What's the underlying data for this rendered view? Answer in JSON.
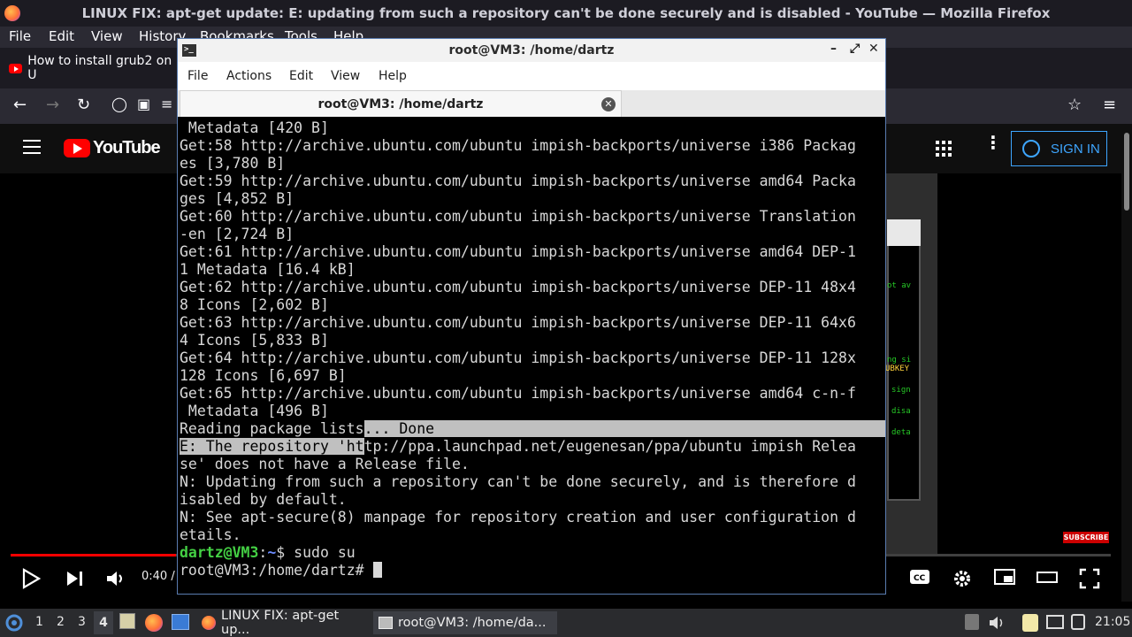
{
  "firefox": {
    "window_title": "LINUX FIX: apt-get update: E: updating from such a repository can't be done securely and is disabled - YouTube — Mozilla Firefox",
    "menu": [
      "File",
      "Edit",
      "View",
      "History",
      "Bookmarks",
      "Tools",
      "Help"
    ],
    "tab_label": "How to install grub2 on U"
  },
  "youtube": {
    "logo_text": "YouTube",
    "sign_in_label": "SIGN IN",
    "subscribe_label": "SUBSCRIBE",
    "time": "0:40 /",
    "inner_screen_lines": [
      "ot av",
      "ng si",
      "UBKEY",
      "sign",
      "disa",
      "deta"
    ],
    "progress": 0.15
  },
  "terminal": {
    "window_title": "root@VM3: /home/dartz",
    "menu": [
      "File",
      "Actions",
      "Edit",
      "View",
      "Help"
    ],
    "tab_title": "root@VM3: /home/dartz",
    "lines": [
      " Metadata [420 B]",
      "Get:58 http://archive.ubuntu.com/ubuntu impish-backports/universe i386 Packag",
      "es [3,780 B]",
      "Get:59 http://archive.ubuntu.com/ubuntu impish-backports/universe amd64 Packa",
      "ges [4,852 B]",
      "Get:60 http://archive.ubuntu.com/ubuntu impish-backports/universe Translation",
      "-en [2,724 B]",
      "Get:61 http://archive.ubuntu.com/ubuntu impish-backports/universe amd64 DEP-1",
      "1 Metadata [16.4 kB]",
      "Get:62 http://archive.ubuntu.com/ubuntu impish-backports/universe DEP-11 48x4",
      "8 Icons [2,602 B]",
      "Get:63 http://archive.ubuntu.com/ubuntu impish-backports/universe DEP-11 64x6",
      "4 Icons [5,833 B]",
      "Get:64 http://archive.ubuntu.com/ubuntu impish-backports/universe DEP-11 128x",
      "128 Icons [6,697 B]",
      "Get:65 http://archive.ubuntu.com/ubuntu impish-backports/universe amd64 c-n-f",
      " Metadata [496 B]"
    ],
    "reading_a": "Reading package lists",
    "reading_b": "... Done",
    "error_a": "E: The repository 'ht",
    "error_b": "tp://ppa.launchpad.net/eugenesan/ppa/ubuntu impish Relea",
    "after_lines": [
      "se' does not have a Release file.",
      "N: Updating from such a repository can't be done securely, and is therefore d",
      "isabled by default.",
      "N: See apt-secure(8) manpage for repository creation and user configuration d",
      "etails."
    ],
    "prompt_user": "dartz@VM3",
    "prompt_colon": ":",
    "prompt_path": "~",
    "prompt_dollar": "$ ",
    "prompt_cmd": "sudo su",
    "root_prompt": "root@VM3:/home/dartz# "
  },
  "taskbar": {
    "workspaces": [
      "1",
      "2",
      "3",
      "4"
    ],
    "active_workspace": "4",
    "firefox_window": "LINUX FIX: apt-get up...",
    "terminal_window": "root@VM3: /home/da...",
    "clock": "21:05"
  },
  "colors": {
    "terminal_bg": "#000000",
    "prompt_green": "#44d044",
    "prompt_blue": "#6c8cff",
    "youtube_red": "#ff0000",
    "signin_blue": "#3ea6ff"
  }
}
